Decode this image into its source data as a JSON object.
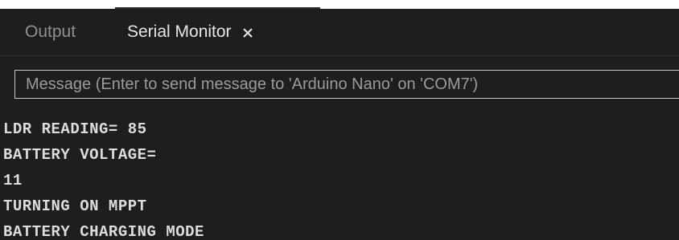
{
  "tabs": {
    "output_label": "Output",
    "serial_monitor_label": "Serial Monitor"
  },
  "icons": {
    "close": "close-icon"
  },
  "message": {
    "placeholder": "Message (Enter to send message to 'Arduino Nano' on 'COM7')",
    "value": ""
  },
  "serial_output": {
    "lines": [
      "LDR READING= 85",
      "BATTERY VOLTAGE=",
      "11",
      "TURNING ON MPPT",
      "BATTERY CHARGING MODE"
    ]
  }
}
